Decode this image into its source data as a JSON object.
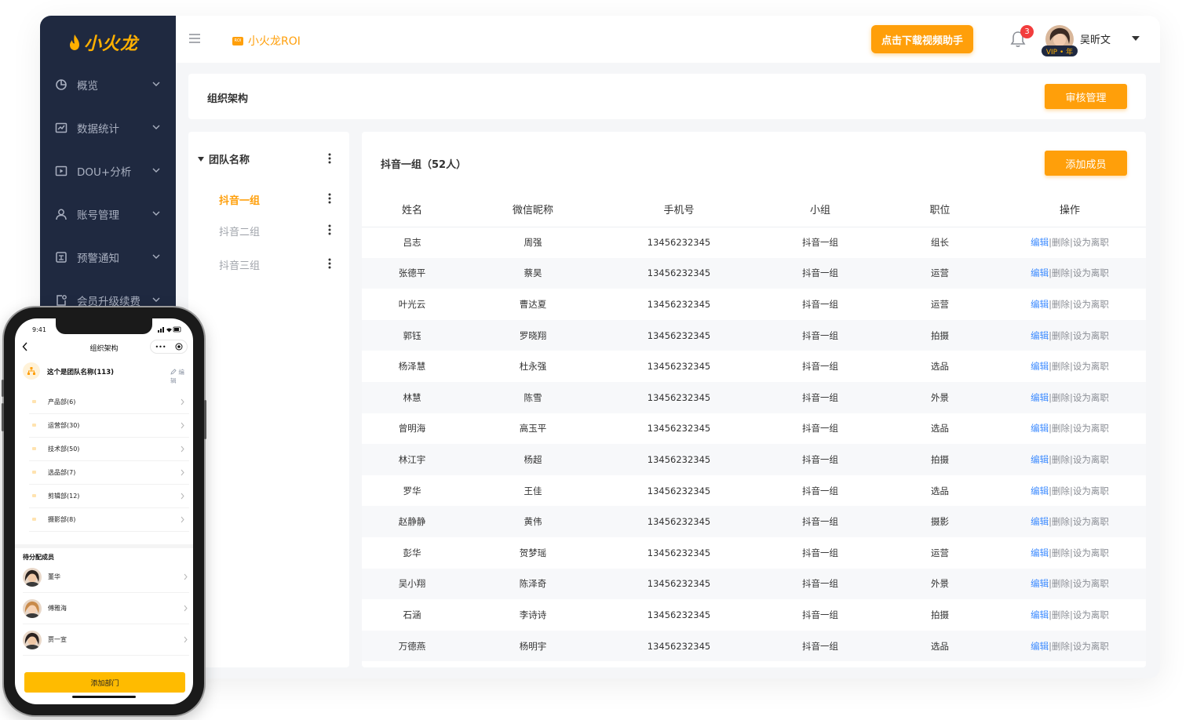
{
  "app": {
    "brand": "小火龙",
    "product_tag": "小火龙ROI",
    "download_button": "点击下载视频助手",
    "notification_count": "3",
    "user_name": "吴昕文",
    "vip_label": "VIP • 年"
  },
  "sidebar": {
    "items": [
      {
        "label": "概览",
        "icon": "pie-chart-icon"
      },
      {
        "label": "数据统计",
        "icon": "line-chart-icon"
      },
      {
        "label": "DOU+分析",
        "icon": "video-play-icon"
      },
      {
        "label": "账号管理",
        "icon": "user-icon"
      },
      {
        "label": "预警通知",
        "icon": "alert-notice-icon"
      },
      {
        "label": "会员升级续费",
        "icon": "member-icon"
      }
    ]
  },
  "page": {
    "title": "组织架构",
    "review_button": "审核管理"
  },
  "tree": {
    "root_label": "团队名称",
    "groups": [
      "抖音一组",
      "抖音二组",
      "抖音三组"
    ],
    "active_index": 0
  },
  "members": {
    "group_title": "抖音一组（52人）",
    "add_button": "添加成员",
    "columns": [
      "姓名",
      "微信昵称",
      "手机号",
      "小组",
      "职位",
      "操作"
    ],
    "actions": {
      "edit": "编辑",
      "delete": "删除",
      "resign": "设为离职",
      "sep": "|"
    },
    "rows": [
      [
        "吕志",
        "周强",
        "13456232345",
        "抖音一组",
        "组长"
      ],
      [
        "张德平",
        "蔡昊",
        "13456232345",
        "抖音一组",
        "运营"
      ],
      [
        "叶光云",
        "曹达夏",
        "13456232345",
        "抖音一组",
        "运营"
      ],
      [
        "郭钰",
        "罗晓翔",
        "13456232345",
        "抖音一组",
        "拍摄"
      ],
      [
        "杨泽慧",
        "杜永强",
        "13456232345",
        "抖音一组",
        "选品"
      ],
      [
        "林慧",
        "陈雪",
        "13456232345",
        "抖音一组",
        "外景"
      ],
      [
        "曾明海",
        "高玉平",
        "13456232345",
        "抖音一组",
        "选品"
      ],
      [
        "林江宇",
        "杨超",
        "13456232345",
        "抖音一组",
        "拍摄"
      ],
      [
        "罗华",
        "王佳",
        "13456232345",
        "抖音一组",
        "选品"
      ],
      [
        "赵静静",
        "黄伟",
        "13456232345",
        "抖音一组",
        "摄影"
      ],
      [
        "彭华",
        "贺梦瑶",
        "13456232345",
        "抖音一组",
        "运营"
      ],
      [
        "吴小翔",
        "陈泽奇",
        "13456232345",
        "抖音一组",
        "外景"
      ],
      [
        "石涵",
        "李诗诗",
        "13456232345",
        "抖音一组",
        "拍摄"
      ],
      [
        "万德燕",
        "杨明宇",
        "13456232345",
        "抖音一组",
        "选品"
      ]
    ]
  },
  "phone": {
    "time": "9:41",
    "nav_title": "组织架构",
    "more": "•••",
    "team_name": "这个是团队名称(113)",
    "edit": "编辑",
    "departments": [
      "产品部(6)",
      "运营部(30)",
      "技术部(50)",
      "选品部(7)",
      "剪辑部(12)",
      "摄影部(8)"
    ],
    "pending_title": "待分配成员",
    "pending_members": [
      "董华",
      "傅雅海",
      "贾一宣"
    ],
    "add_button": "添加部门"
  },
  "colors": {
    "accent": "#ff9f0a",
    "sidebar_bg": "#1f2940",
    "link": "#3d8bff",
    "phone_button": "#ffbb00"
  }
}
